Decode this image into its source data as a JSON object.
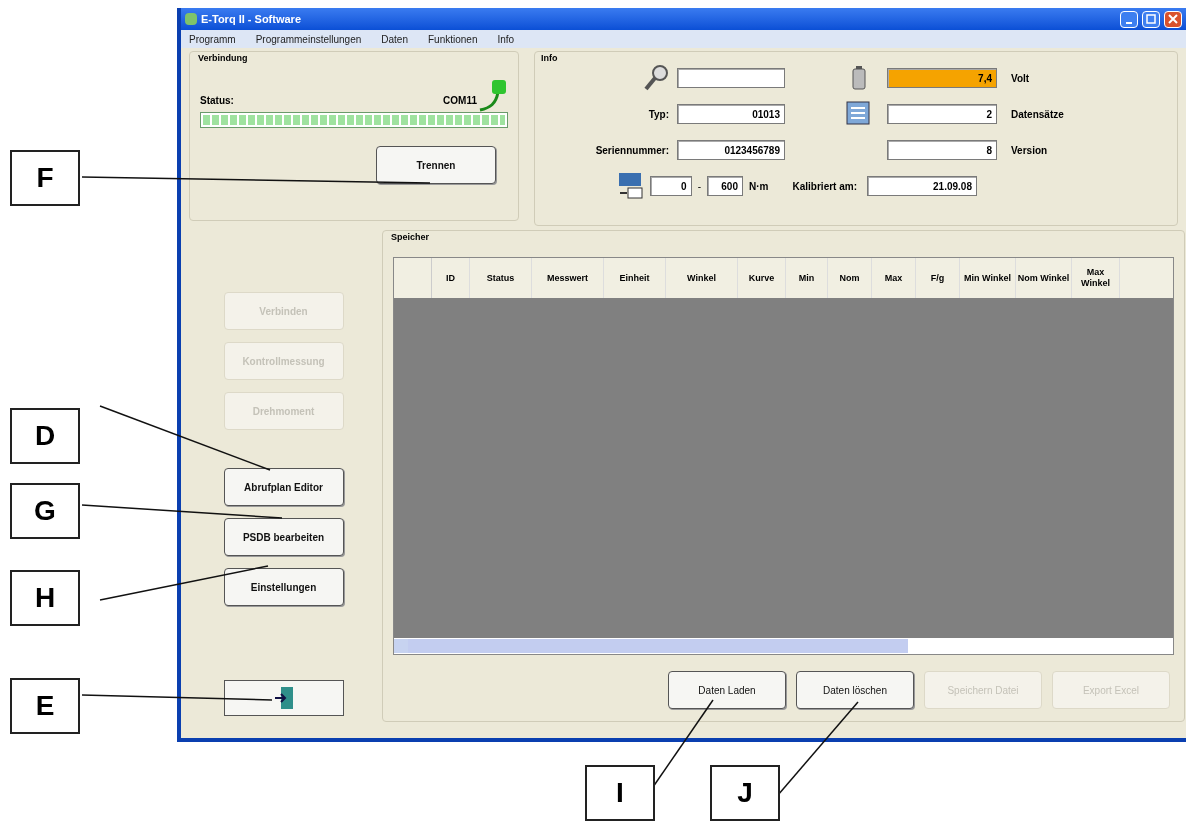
{
  "window": {
    "title": "E-Torq II - Software"
  },
  "menu": [
    "Programm",
    "Programmeinstellungen",
    "Daten",
    "Funktionen",
    "Info"
  ],
  "connection": {
    "title": "Verbindung",
    "status_label": "Status:",
    "port": "COM11",
    "progress": {
      "level": 1.0
    },
    "button": "Trennen"
  },
  "info": {
    "title": "Info",
    "left": [
      {
        "kind": "icon"
      },
      {
        "kind": "label",
        "label": "Typ:",
        "value": "01013"
      },
      {
        "kind": "label",
        "label": "Seriennummer:",
        "value": "0123456789"
      }
    ],
    "range": {
      "from": "0",
      "separator": "-",
      "to": "600",
      "unit": "N·m"
    },
    "right": [
      {
        "value": "7,4",
        "unit": "Volt",
        "warning": true
      },
      {
        "value": "2",
        "unit": "Datensätze",
        "warning": false
      },
      {
        "value": "8",
        "unit": "Version",
        "warning": false
      }
    ],
    "calibration": {
      "label": "Kalibriert am:",
      "value": "21.09.08"
    }
  },
  "side_buttons": [
    {
      "label": "Verbinden",
      "disabled": true
    },
    {
      "label": "Kontrollmessung",
      "disabled": true
    },
    {
      "label": "Drehmoment",
      "disabled": true
    },
    {
      "label": "Abrufplan Editor",
      "disabled": false
    },
    {
      "label": "PSDB bearbeiten",
      "disabled": false
    },
    {
      "label": "Einstellungen",
      "disabled": false
    }
  ],
  "memory": {
    "title": "Speicher",
    "columns": [
      "ID",
      "Status",
      "Messwert",
      "Einheit",
      "Winkel",
      "Kurve",
      "Min",
      "Nom",
      "Max",
      "F/g",
      "Min Winkel",
      "Nom Winkel",
      "Max Winkel"
    ],
    "buttons": [
      {
        "label": "Daten Laden",
        "disabled": false
      },
      {
        "label": "Daten löschen",
        "disabled": false
      },
      {
        "label": "Speichern Datei",
        "disabled": true
      },
      {
        "label": "Export Excel",
        "disabled": true
      }
    ]
  },
  "callouts": [
    "F",
    "D",
    "G",
    "H",
    "E",
    "I",
    "J"
  ]
}
